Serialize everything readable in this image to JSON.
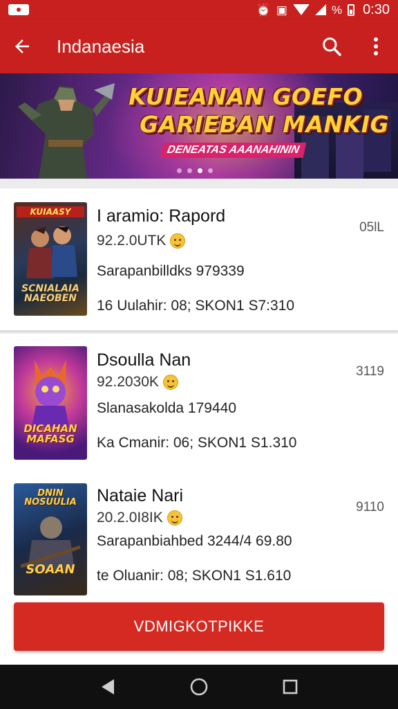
{
  "status_bar": {
    "icons": [
      "notification-icon",
      "alarm-icon",
      "nfc-icon",
      "wifi-icon",
      "signal-icon",
      "battery-icon"
    ],
    "battery_text": "%",
    "time": "0:30"
  },
  "app_bar": {
    "title": "Indanaesia",
    "back_icon": "arrow-left-icon",
    "search_icon": "search-icon",
    "menu_icon": "more-vert-icon",
    "color": "#c8201e"
  },
  "banner": {
    "title_line1": "KUIEANAN GOEFO",
    "title_line2": "GARIEBAN MANKIG",
    "subtitle": "DENEATAS AAANAHININ",
    "carousel_pages": 4,
    "carousel_active": 3
  },
  "list": {
    "items": [
      {
        "cover_text": "KUIAASY",
        "cover_text2": "SCNIALAIA NAEOBEN",
        "title": "I aramio: Rapord",
        "meta": "92.2.0UTK",
        "description": "Sarapanbilldks 979339",
        "detail": "16 Uulahir:  08; SKON1 S7:310",
        "side": "05lL"
      },
      {
        "cover_text": "",
        "cover_text2": "DICAHAN MAFASG",
        "title": "Dsoulla Nan",
        "meta": "92.2030K",
        "description": "Slanasakolda 179440",
        "detail": "Ka Cmanir:  06; SKON1 S1.310",
        "side": "3119"
      },
      {
        "cover_text": "DNIN NOSUULIA",
        "cover_text2": "SOAAN",
        "title": "Nataie Nari",
        "meta": "20.2.0I8IK",
        "description": "Sarapanbiahbed 3244/4 69.80",
        "detail": "te Oluanir:  08; SKON1 S1.610",
        "side": "9110"
      }
    ]
  },
  "cta": {
    "label": "VDMIGKOTPIKKE",
    "color": "#d42a22"
  },
  "nav_bar": {
    "back_icon": "nav-back-icon",
    "home_icon": "nav-home-icon",
    "recents_icon": "nav-recents-icon"
  }
}
